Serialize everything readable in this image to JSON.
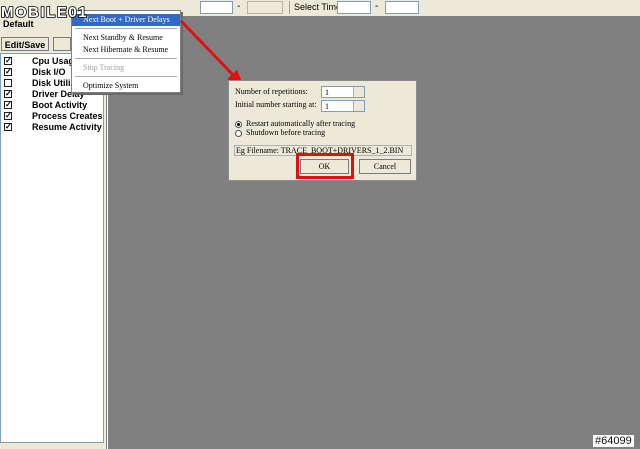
{
  "logo": {
    "text": "MOBILE01"
  },
  "toolbar": {
    "dash1": "-",
    "select_time_label": "Select Time",
    "dash2": "-"
  },
  "left_panel": {
    "profile_label": "Default",
    "edit_save_label": "Edit/Save",
    "items": [
      {
        "label": "Cpu Usage",
        "checked": true
      },
      {
        "label": "Disk I/O",
        "checked": true
      },
      {
        "label": "Disk Utiliz",
        "checked": false
      },
      {
        "label": "Driver Delay",
        "checked": true
      },
      {
        "label": "Boot Activity",
        "checked": true
      },
      {
        "label": "Process Creates",
        "checked": true
      },
      {
        "label": "Resume Activity",
        "checked": true
      }
    ]
  },
  "context_menu": {
    "items": [
      {
        "label": "Next Boot + Driver Delays",
        "selected": true
      },
      {
        "label": "Next Standby & Resume"
      },
      {
        "label": "Next Hibernate & Resume"
      },
      {
        "label": "Stop Tracing",
        "disabled": true
      },
      {
        "label": "Optimize System"
      }
    ]
  },
  "dialog": {
    "repetitions_label": "Number of repetitions:",
    "repetitions_value": "1",
    "initial_number_label": "Initial number starting at:",
    "initial_number_value": "1",
    "restart_label": "Restart automatically after tracing",
    "shutdown_label": "Shutdown before tracing",
    "filename_label": "Eg Filename: TRACE_BOOT+DRIVERS_1_2.BIN",
    "ok_label": "OK",
    "cancel_label": "Cancel"
  },
  "colors": {
    "menu_highlight": "#3169c6",
    "annotation_red": "#e01010",
    "main_background": "#808080"
  },
  "watermark": "#64099"
}
